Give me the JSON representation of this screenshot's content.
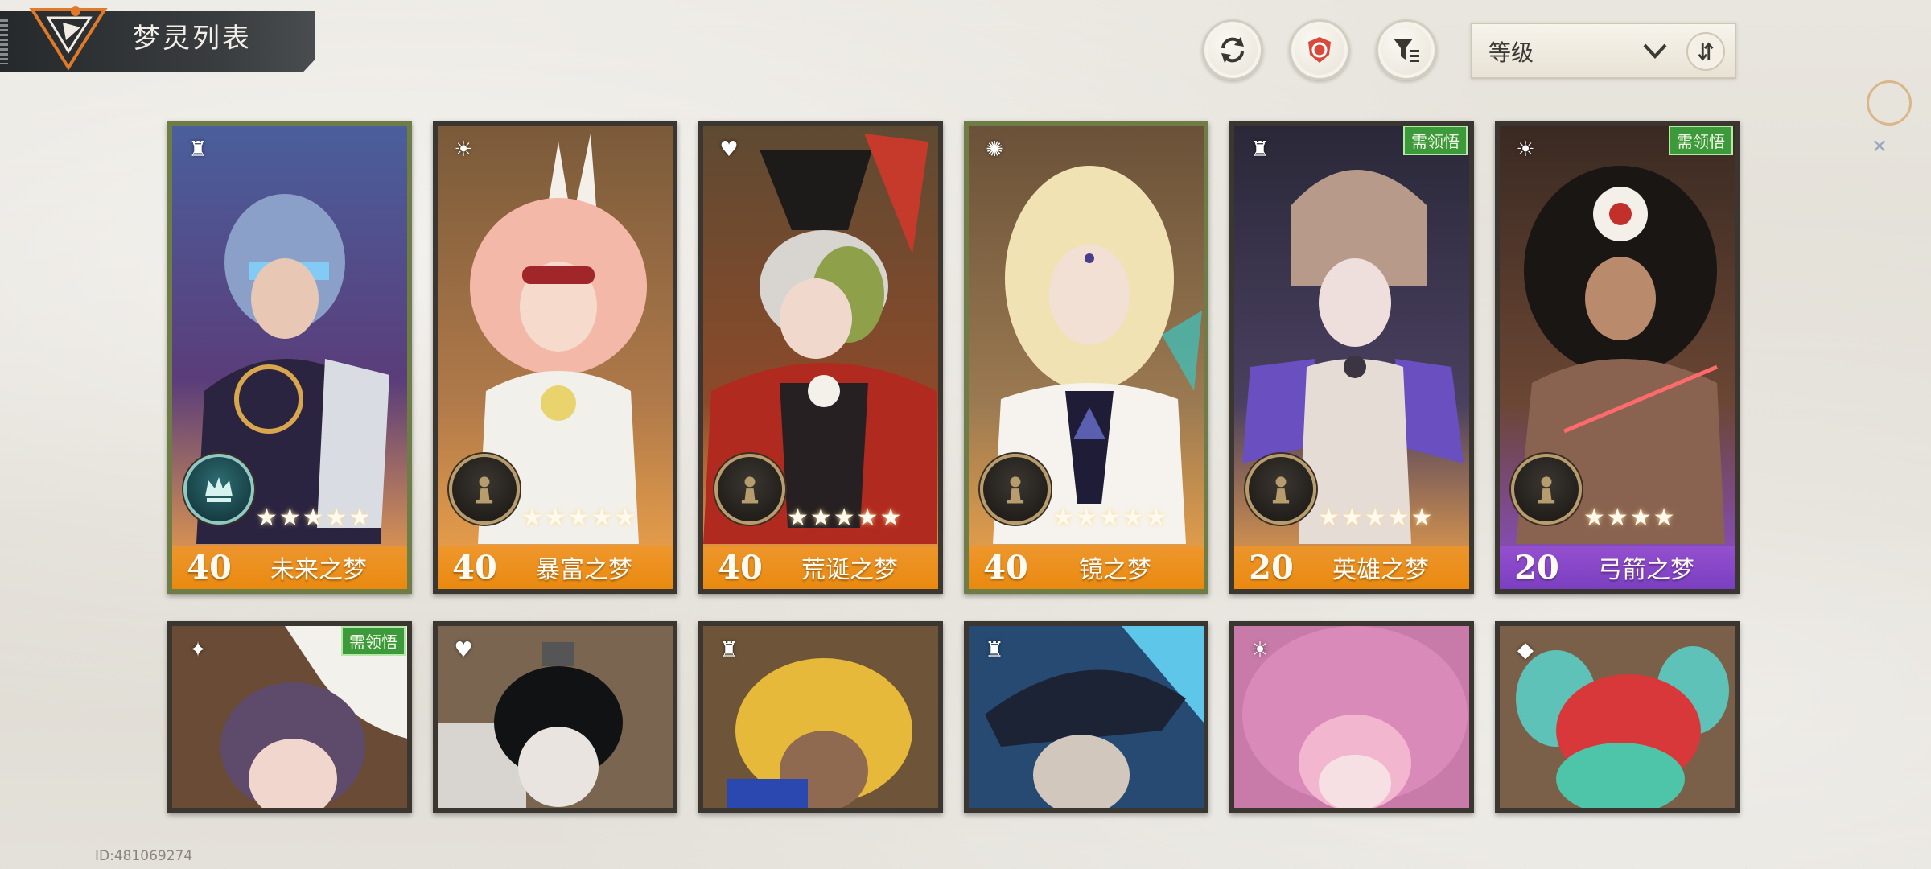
{
  "header": {
    "title": "梦灵列表",
    "refresh_icon": "refresh-icon",
    "target_icon": "target-icon",
    "filter_icon": "filter-icon"
  },
  "sort": {
    "label": "等级",
    "icon": "chevron-down-icon",
    "order_icon": "sort-order-icon"
  },
  "cards_row1": [
    {
      "level": "40",
      "name": "未来之梦",
      "stars": "★★★★★",
      "element": "ruin",
      "badge": "",
      "rarity_color": "#e9890f",
      "frame": "green"
    },
    {
      "level": "40",
      "name": "暴富之梦",
      "stars": "★★★★★",
      "element": "sun",
      "badge": "",
      "rarity_color": "#e9890f",
      "frame": "dark"
    },
    {
      "level": "40",
      "name": "荒诞之梦",
      "stars": "★★★★★",
      "element": "heart",
      "badge": "",
      "rarity_color": "#e9890f",
      "frame": "dark"
    },
    {
      "level": "40",
      "name": "镜之梦",
      "stars": "★★★★★",
      "element": "light",
      "badge": "",
      "rarity_color": "#e9890f",
      "frame": "green"
    },
    {
      "level": "20",
      "name": "英雄之梦",
      "stars": "★★★★★",
      "element": "ruin",
      "badge": "需领悟",
      "rarity_color": "#e9890f",
      "frame": "dark"
    },
    {
      "level": "20",
      "name": "弓箭之梦",
      "stars": "★★★★",
      "element": "sun",
      "badge": "需领悟",
      "rarity_color": "#7a3fc0",
      "frame": "dark"
    }
  ],
  "cards_row2": [
    {
      "element": "orbit",
      "badge": "需领悟"
    },
    {
      "element": "heart",
      "badge": ""
    },
    {
      "element": "ruin",
      "badge": ""
    },
    {
      "element": "ruin",
      "badge": ""
    },
    {
      "element": "sun",
      "badge": ""
    },
    {
      "element": "crystal",
      "badge": ""
    }
  ],
  "footer": {
    "uid": "ID:481069274"
  }
}
